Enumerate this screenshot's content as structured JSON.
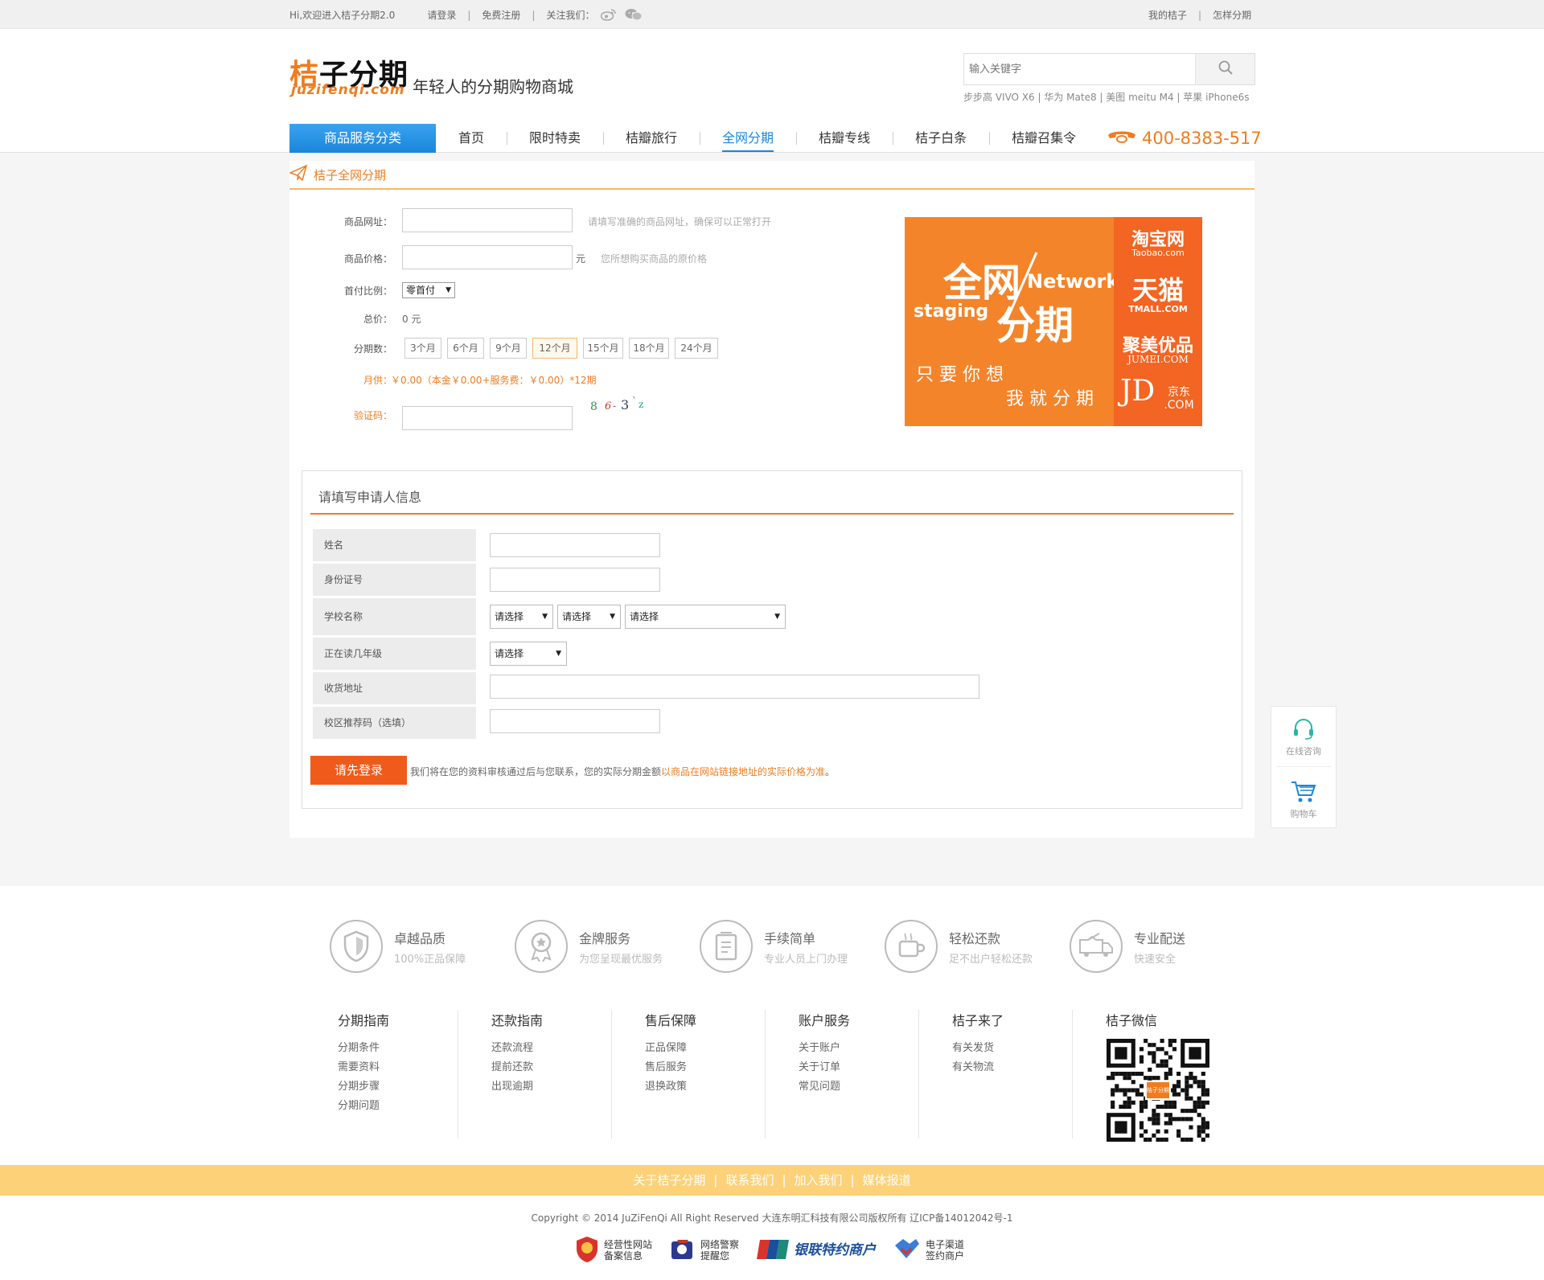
{
  "topbar": {
    "welcome": "Hi,欢迎进入桔子分期2.0",
    "login": "请登录",
    "register": "免费注册",
    "follow": "关注我们：",
    "my_account": "我的桔子",
    "how_to": "怎样分期"
  },
  "header": {
    "logo_cn_a": "桔",
    "logo_cn_b": "子分期",
    "logo_en": "juzifenqi.com",
    "slogan": "年轻人的分期购物商城",
    "search_placeholder": "输入关键字",
    "hot_keywords": "步步高 VIVO X6 | 华为 Mate8 | 美图 meitu M4 | 苹果 iPhone6s",
    "category_button": "商品服务分类",
    "phone": "400-8383-517"
  },
  "nav": [
    {
      "label": "首页",
      "active": false
    },
    {
      "label": "限时特卖",
      "active": false
    },
    {
      "label": "桔瓣旅行",
      "active": false
    },
    {
      "label": "全网分期",
      "active": true
    },
    {
      "label": "桔瓣专线",
      "active": false
    },
    {
      "label": "桔子白条",
      "active": false
    },
    {
      "label": "桔瓣召集令",
      "active": false
    }
  ],
  "main": {
    "breadcrumb": "桔子全网分期",
    "form": {
      "url_label": "商品网址：",
      "url_hint": "请填写准确的商品网址，确保可以正常打开",
      "price_label": "商品价格：",
      "price_unit": "元",
      "price_hint": "您所想购买商品的原价格",
      "down_label": "首付比例：",
      "down_value": "零首付",
      "total_label": "总价：",
      "total_value": "0 元",
      "periods_label": "分期数：",
      "periods": [
        "3个月",
        "6个月",
        "9个月",
        "12个月",
        "15个月",
        "18个月",
        "24个月"
      ],
      "selected_period": "12个月",
      "monthly_label": "月供：",
      "monthly_value": "￥0.00（本金￥0.00+服务费：￥0.00）*12期",
      "captcha_label": "验证码：",
      "captcha_chars": [
        "8",
        "6",
        "-",
        "3",
        "`",
        "z"
      ]
    },
    "banner": {
      "big_a": "全网",
      "big_b": "分期",
      "en_a": "Network",
      "en_b": "staging",
      "line1": "只 要 你 想",
      "line2": "我 就 分 期",
      "shops": [
        {
          "name": "淘宝网",
          "sub": "Taobao.com"
        },
        {
          "name": "天猫",
          "sub": "TMALL.COM"
        },
        {
          "name": "聚美优品",
          "sub": "JUMEI.COM"
        },
        {
          "name": "JD",
          "sub": "京东 .COM"
        }
      ]
    },
    "applicant": {
      "title": "请填写申请人信息",
      "name_label": "姓名",
      "id_label": "身份证号",
      "school_label": "学校名称",
      "school_select": [
        "请选择",
        "请选择",
        "请选择"
      ],
      "grade_label": "正在读几年级",
      "grade_select": "请选择",
      "address_label": "收货地址",
      "referral_label": "校区推荐码（选填）",
      "login_button": "请先登录",
      "note_a": "我们将在您的资料审核通过后与您联系，您的实际分期金额",
      "note_b": "以商品在网站链接地址的实际价格为准",
      "note_c": "。"
    }
  },
  "float": {
    "consult": "在线咨询",
    "cart": "购物车"
  },
  "footer": {
    "features": [
      {
        "title": "卓越品质",
        "sub": "100%正品保障",
        "icon": "shield-icon"
      },
      {
        "title": "金牌服务",
        "sub": "为您呈现最优服务",
        "icon": "medal-icon"
      },
      {
        "title": "手续简单",
        "sub": "专业人员上门办理",
        "icon": "clipboard-icon"
      },
      {
        "title": "轻松还款",
        "sub": "足不出户轻松还款",
        "icon": "cup-icon"
      },
      {
        "title": "专业配送",
        "sub": "快速安全",
        "icon": "truck-icon"
      }
    ],
    "columns": [
      {
        "title": "分期指南",
        "links": [
          "分期条件",
          "需要资料",
          "分期步骤",
          "分期问题"
        ]
      },
      {
        "title": "还款指南",
        "links": [
          "还款流程",
          "提前还款",
          "出现逾期"
        ]
      },
      {
        "title": "售后保障",
        "links": [
          "正品保障",
          "售后服务",
          "退换政策"
        ]
      },
      {
        "title": "账户服务",
        "links": [
          "关于账户",
          "关于订单",
          "常见问题"
        ]
      },
      {
        "title": "桔子来了",
        "links": [
          "有关发货",
          "有关物流"
        ]
      },
      {
        "title": "桔子微信",
        "links": []
      }
    ],
    "qr_label": "桔子分期",
    "bottom_links": [
      "关于桔子分期",
      "联系我们",
      "加入我们",
      "媒体报道"
    ],
    "copyright": "Copyright © 2014 JuZiFenQi All Right Reserved 大连东明汇科技有限公司版权所有 辽ICP备14012042号-1",
    "badges": [
      {
        "line1": "经营性网站",
        "line2": "备案信息"
      },
      {
        "line1": "网络警察",
        "line2": "提醒您"
      },
      {
        "line1": "银联特约商户",
        "line2": ""
      },
      {
        "line1": "电子渠道",
        "line2": "签约商户"
      }
    ]
  },
  "colors": {
    "brand_orange": "#f07c1e",
    "nav_blue": "#1a86da",
    "login_button": "#f05a1a",
    "footer_link_bar": "#fdd178"
  }
}
